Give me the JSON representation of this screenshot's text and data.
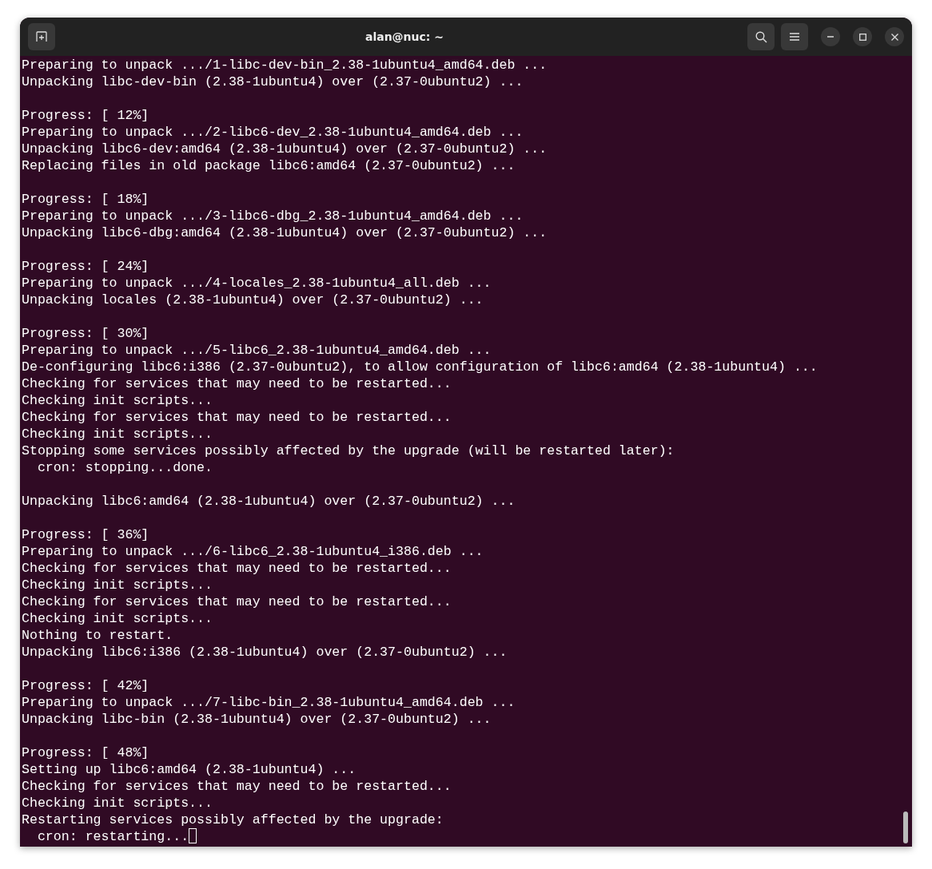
{
  "window": {
    "title": "alan@nuc: ~"
  },
  "terminal": {
    "blocks": [
      [
        "Preparing to unpack .../1-libc-dev-bin_2.38-1ubuntu4_amd64.deb ...",
        "Unpacking libc-dev-bin (2.38-1ubuntu4) over (2.37-0ubuntu2) ..."
      ],
      [
        "Progress: [ 12%]",
        "Preparing to unpack .../2-libc6-dev_2.38-1ubuntu4_amd64.deb ...",
        "Unpacking libc6-dev:amd64 (2.38-1ubuntu4) over (2.37-0ubuntu2) ...",
        "Replacing files in old package libc6:amd64 (2.37-0ubuntu2) ..."
      ],
      [
        "Progress: [ 18%]",
        "Preparing to unpack .../3-libc6-dbg_2.38-1ubuntu4_amd64.deb ...",
        "Unpacking libc6-dbg:amd64 (2.38-1ubuntu4) over (2.37-0ubuntu2) ..."
      ],
      [
        "Progress: [ 24%]",
        "Preparing to unpack .../4-locales_2.38-1ubuntu4_all.deb ...",
        "Unpacking locales (2.38-1ubuntu4) over (2.37-0ubuntu2) ..."
      ],
      [
        "Progress: [ 30%]",
        "Preparing to unpack .../5-libc6_2.38-1ubuntu4_amd64.deb ...",
        "De-configuring libc6:i386 (2.37-0ubuntu2), to allow configuration of libc6:amd64 (2.38-1ubuntu4) ...",
        "Checking for services that may need to be restarted...",
        "Checking init scripts...",
        "Checking for services that may need to be restarted...",
        "Checking init scripts...",
        "Stopping some services possibly affected by the upgrade (will be restarted later):",
        "  cron: stopping...done."
      ],
      [
        "Unpacking libc6:amd64 (2.38-1ubuntu4) over (2.37-0ubuntu2) ..."
      ],
      [
        "Progress: [ 36%]",
        "Preparing to unpack .../6-libc6_2.38-1ubuntu4_i386.deb ...",
        "Checking for services that may need to be restarted...",
        "Checking init scripts...",
        "Checking for services that may need to be restarted...",
        "Checking init scripts...",
        "Nothing to restart.",
        "Unpacking libc6:i386 (2.38-1ubuntu4) over (2.37-0ubuntu2) ..."
      ],
      [
        "Progress: [ 42%]",
        "Preparing to unpack .../7-libc-bin_2.38-1ubuntu4_amd64.deb ...",
        "Unpacking libc-bin (2.38-1ubuntu4) over (2.37-0ubuntu2) ..."
      ],
      [
        "Progress: [ 48%]",
        "Setting up libc6:amd64 (2.38-1ubuntu4) ...",
        "Checking for services that may need to be restarted...",
        "Checking init scripts...",
        "Restarting services possibly affected by the upgrade:",
        "  cron: restarting..."
      ]
    ]
  }
}
